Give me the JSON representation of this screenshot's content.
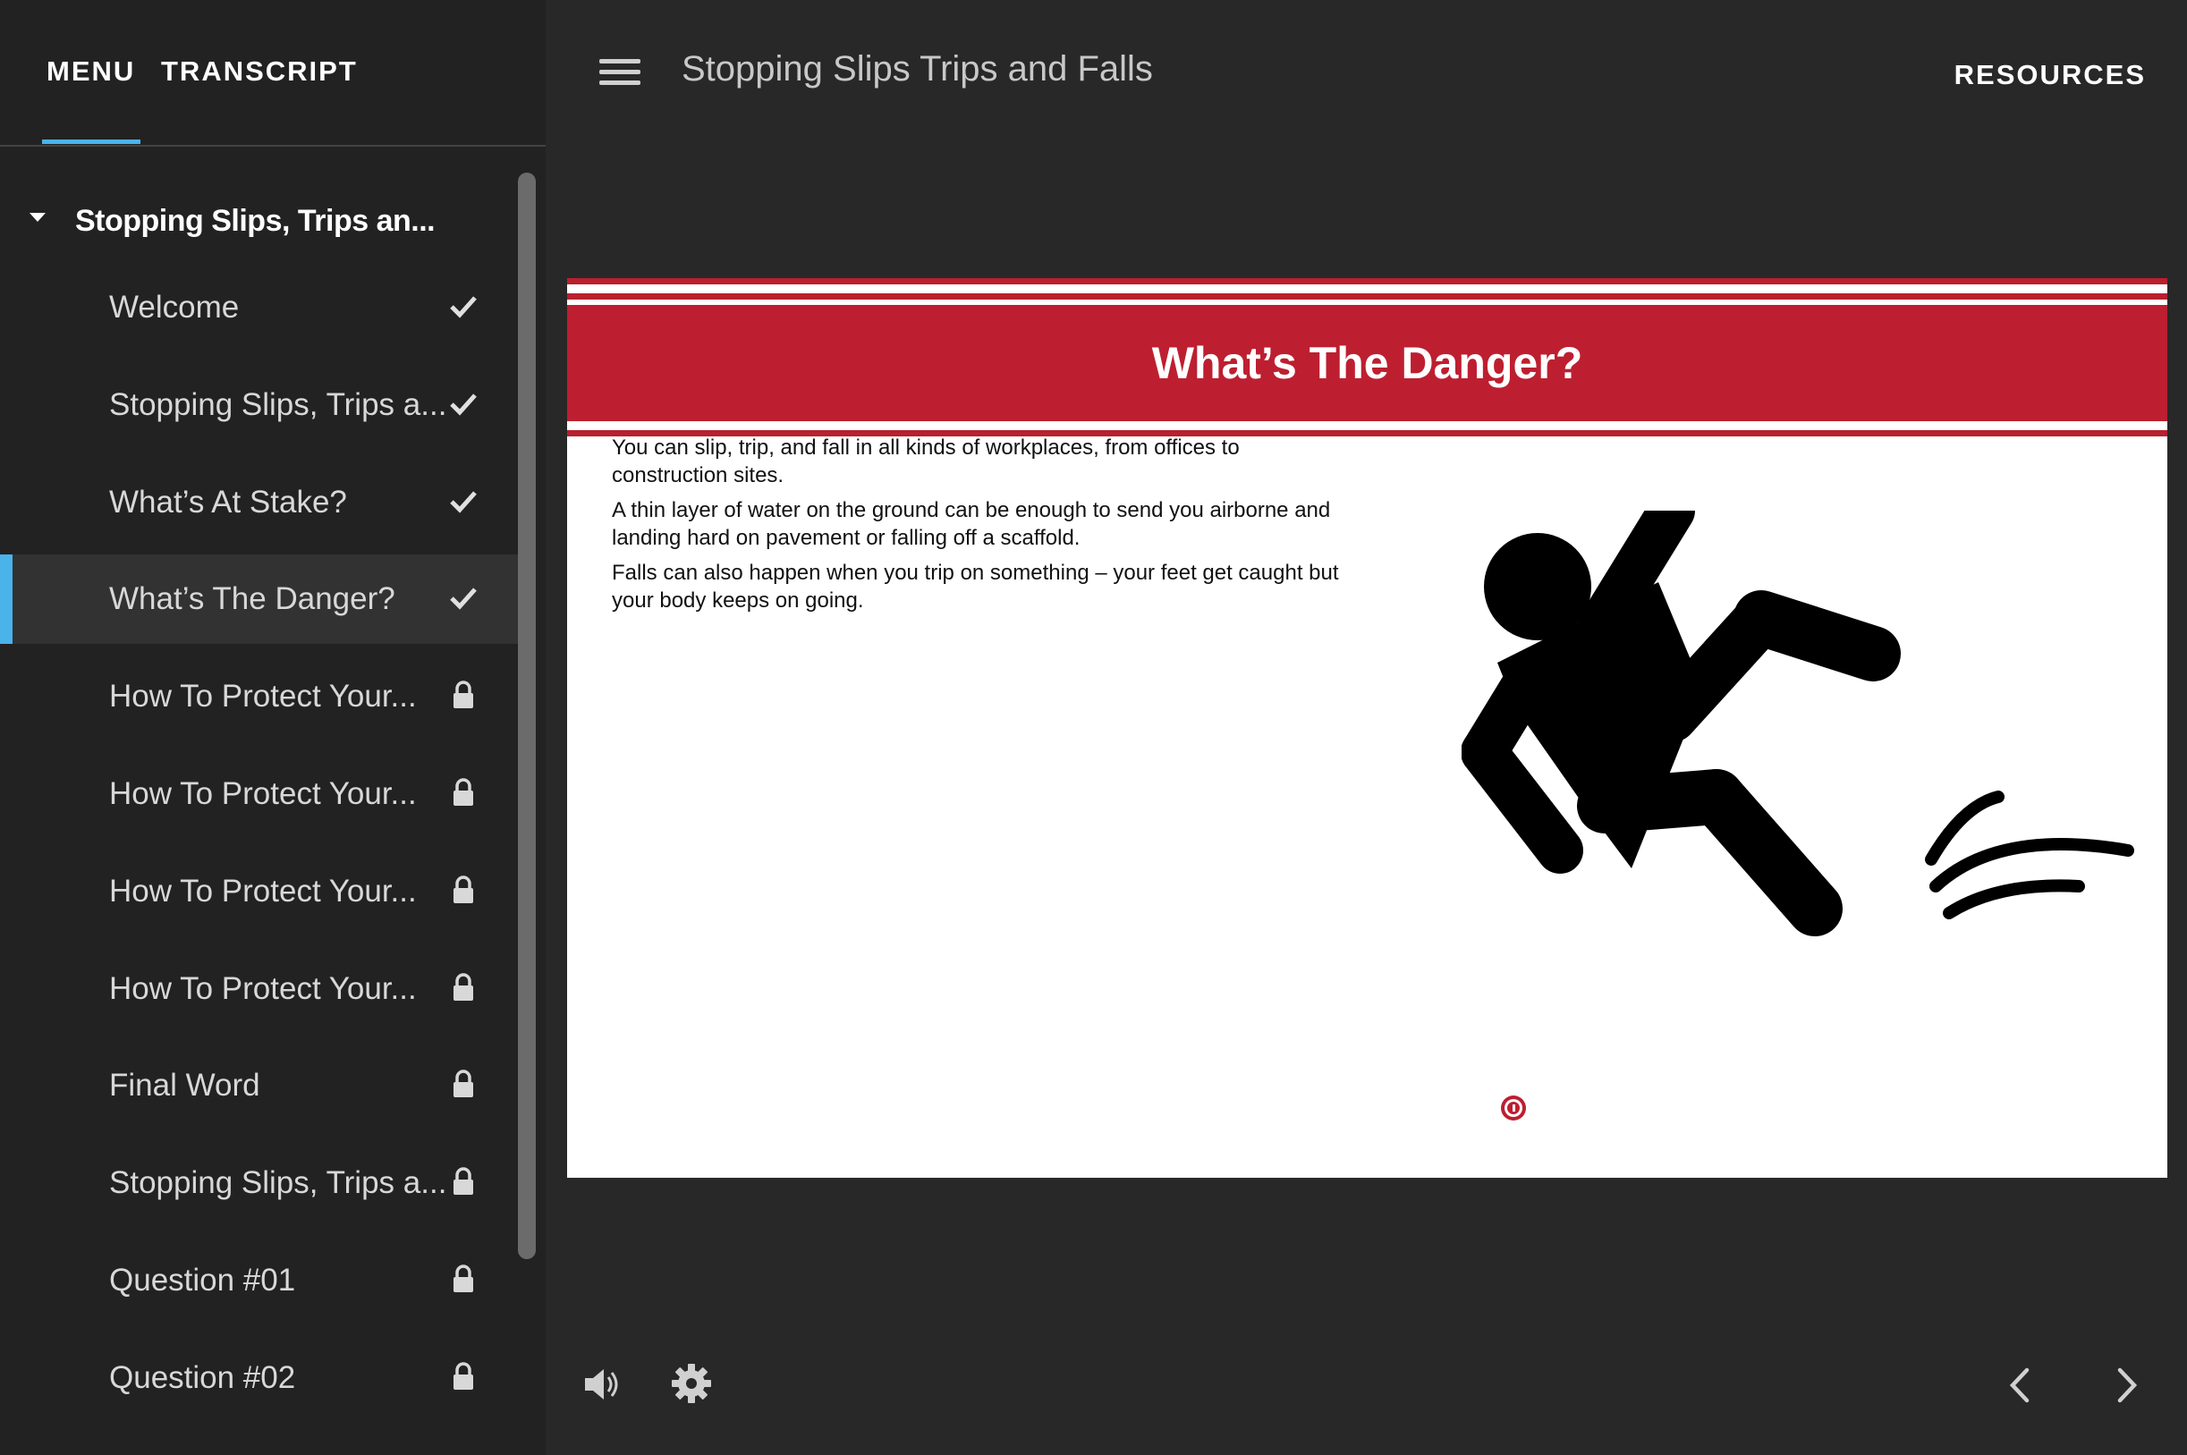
{
  "sidebar": {
    "tabs": [
      {
        "label": "MENU",
        "active": true
      },
      {
        "label": "TRANSCRIPT",
        "active": false
      }
    ],
    "section_title": "Stopping Slips, Trips an...",
    "items": [
      {
        "label": "Welcome",
        "status": "complete"
      },
      {
        "label": "Stopping Slips, Trips a...",
        "status": "complete"
      },
      {
        "label": "What’s At Stake?",
        "status": "complete"
      },
      {
        "label": "What’s The Danger?",
        "status": "complete",
        "active": true
      },
      {
        "label": "How To Protect Your...",
        "status": "locked"
      },
      {
        "label": "How To Protect Your...",
        "status": "locked"
      },
      {
        "label": "How To Protect Your...",
        "status": "locked"
      },
      {
        "label": "How To Protect Your...",
        "status": "locked"
      },
      {
        "label": "Final Word",
        "status": "locked"
      },
      {
        "label": "Stopping Slips, Trips a...",
        "status": "locked"
      },
      {
        "label": "Question #01",
        "status": "locked"
      },
      {
        "label": "Question #02",
        "status": "locked"
      }
    ]
  },
  "header": {
    "course_title": "Stopping Slips Trips and Falls",
    "resources_label": "RESOURCES"
  },
  "slide": {
    "heading": "What’s The Danger?",
    "paragraphs": [
      "You can slip, trip, and fall in all kinds of workplaces, from offices to construction sites.",
      "A thin layer of water on the ground can be enough to send you airborne and landing hard on pavement or falling off a scaffold.",
      "Falls can also happen when you trip on something – your feet get caught but your body keeps on going."
    ],
    "image": "person-slipping-pictogram"
  },
  "controls": {
    "icons": [
      "volume-icon",
      "gear-icon",
      "chevron-left-icon",
      "chevron-right-icon"
    ]
  },
  "colors": {
    "accent": "#4ab3ea",
    "brand_red": "#bd1f30",
    "background": "#282828",
    "sidebar": "#222222"
  }
}
